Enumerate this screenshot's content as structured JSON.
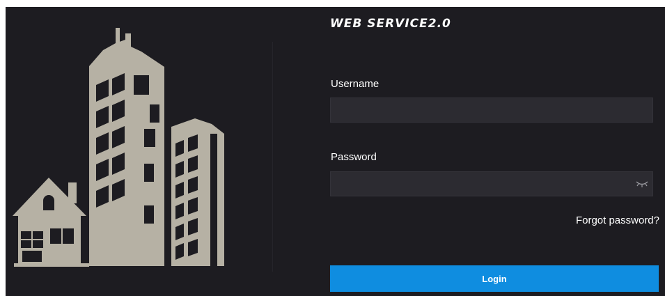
{
  "app": {
    "title": "WEB SERVICE2.0"
  },
  "form": {
    "username_label": "Username",
    "username_value": "",
    "password_label": "Password",
    "password_value": "",
    "password_toggle_icon": "eye-closed-icon",
    "forgot_password": "Forgot password?",
    "login_label": "Login"
  },
  "colors": {
    "background": "#1d1c21",
    "input_background": "#2c2b31",
    "illustration": "#b6b1a4",
    "accent": "#0f8de0",
    "text": "#ffffff"
  }
}
